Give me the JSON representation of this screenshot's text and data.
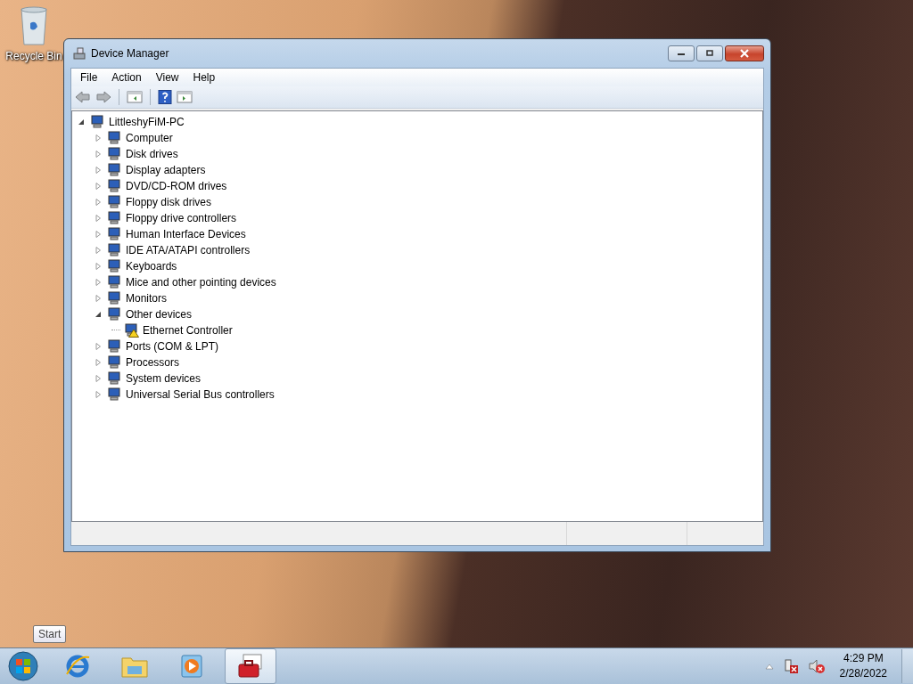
{
  "desktop": {
    "icons": [
      {
        "kind": "recycle-bin",
        "label": "Recycle Bin"
      }
    ]
  },
  "window": {
    "title": "Device Manager",
    "menu": [
      "File",
      "Action",
      "View",
      "Help"
    ],
    "toolbar": [
      {
        "kind": "back"
      },
      {
        "kind": "forward"
      },
      {
        "kind": "separator"
      },
      {
        "kind": "tree-pane"
      },
      {
        "kind": "separator"
      },
      {
        "kind": "help"
      },
      {
        "kind": "action-pane"
      }
    ],
    "tree": {
      "label": "LittleshyFiM-PC",
      "expanded": true,
      "warning": false,
      "children": [
        {
          "label": "Computer",
          "expanded": false,
          "warning": false
        },
        {
          "label": "Disk drives",
          "expanded": false,
          "warning": false
        },
        {
          "label": "Display adapters",
          "expanded": false,
          "warning": false
        },
        {
          "label": "DVD/CD-ROM drives",
          "expanded": false,
          "warning": false
        },
        {
          "label": "Floppy disk drives",
          "expanded": false,
          "warning": false
        },
        {
          "label": "Floppy drive controllers",
          "expanded": false,
          "warning": false
        },
        {
          "label": "Human Interface Devices",
          "expanded": false,
          "warning": false
        },
        {
          "label": "IDE ATA/ATAPI controllers",
          "expanded": false,
          "warning": false
        },
        {
          "label": "Keyboards",
          "expanded": false,
          "warning": false
        },
        {
          "label": "Mice and other pointing devices",
          "expanded": false,
          "warning": false
        },
        {
          "label": "Monitors",
          "expanded": false,
          "warning": false
        },
        {
          "label": "Other devices",
          "expanded": true,
          "warning": false,
          "children": [
            {
              "label": "Ethernet Controller",
              "warning": true
            }
          ]
        },
        {
          "label": "Ports (COM & LPT)",
          "expanded": false,
          "warning": false
        },
        {
          "label": "Processors",
          "expanded": false,
          "warning": false
        },
        {
          "label": "System devices",
          "expanded": false,
          "warning": false
        },
        {
          "label": "Universal Serial Bus controllers",
          "expanded": false,
          "warning": false
        }
      ]
    }
  },
  "taskbar": {
    "tooltip": "Start",
    "apps": [
      {
        "kind": "browser",
        "selected": false
      },
      {
        "kind": "folder",
        "selected": false
      },
      {
        "kind": "media",
        "selected": false
      },
      {
        "kind": "toolbox",
        "selected": true
      }
    ],
    "clock": {
      "time": "4:29 PM",
      "date": "2/28/2022"
    }
  }
}
